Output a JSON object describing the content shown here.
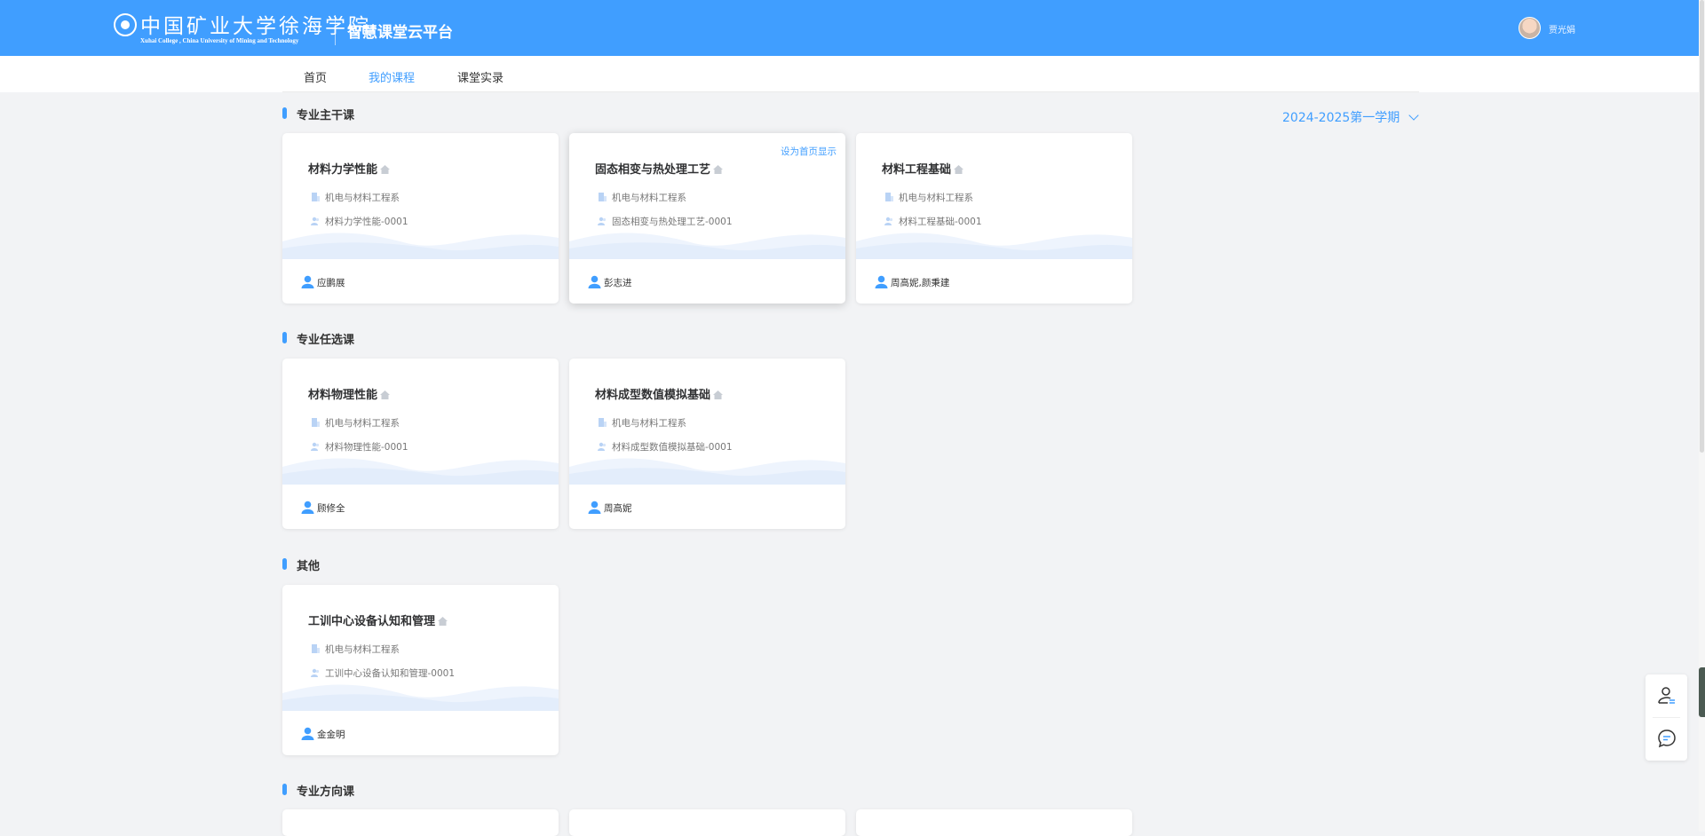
{
  "header": {
    "logo_cn": "中国矿业大学徐海学院",
    "logo_en": "Xuhai College , China University of Mining and Technology",
    "platform_title": "智慧课堂云平台",
    "username": "贾光娟"
  },
  "nav": {
    "items": [
      "首页",
      "我的课程",
      "课堂实录"
    ],
    "active_index": 1
  },
  "term_selector": {
    "label": "2024-2025第一学期"
  },
  "sections": [
    {
      "title": "专业主干课",
      "courses": [
        {
          "title": "材料力学性能",
          "dept": "机电与材料工程系",
          "class": "材料力学性能-0001",
          "teacher": "应鹏展"
        },
        {
          "title": "固态相变与热处理工艺",
          "dept": "机电与材料工程系",
          "class": "固态相变与热处理工艺-0001",
          "teacher": "彭志进",
          "hover_action": "设为首页显示"
        },
        {
          "title": "材料工程基础",
          "dept": "机电与材料工程系",
          "class": "材料工程基础-0001",
          "teacher": "周高妮,颜秉建"
        }
      ]
    },
    {
      "title": "专业任选课",
      "courses": [
        {
          "title": "材料物理性能",
          "dept": "机电与材料工程系",
          "class": "材料物理性能-0001",
          "teacher": "顾修全"
        },
        {
          "title": "材料成型数值模拟基础",
          "dept": "机电与材料工程系",
          "class": "材料成型数值模拟基础-0001",
          "teacher": "周高妮"
        }
      ]
    },
    {
      "title": "其他",
      "courses": [
        {
          "title": "工训中心设备认知和管理",
          "dept": "机电与材料工程系",
          "class": "工训中心设备认知和管理-0001",
          "teacher": "金金明"
        }
      ]
    },
    {
      "title": "专业方向课",
      "courses": []
    }
  ],
  "icons": {
    "home": "home-icon",
    "building": "building-icon",
    "class": "users-icon",
    "teacher": "user-icon",
    "float_user": "user-switch-icon",
    "float_chat": "chat-icon"
  },
  "colors": {
    "primary": "#409eff",
    "background": "#f2f3f5",
    "card": "#ffffff"
  }
}
